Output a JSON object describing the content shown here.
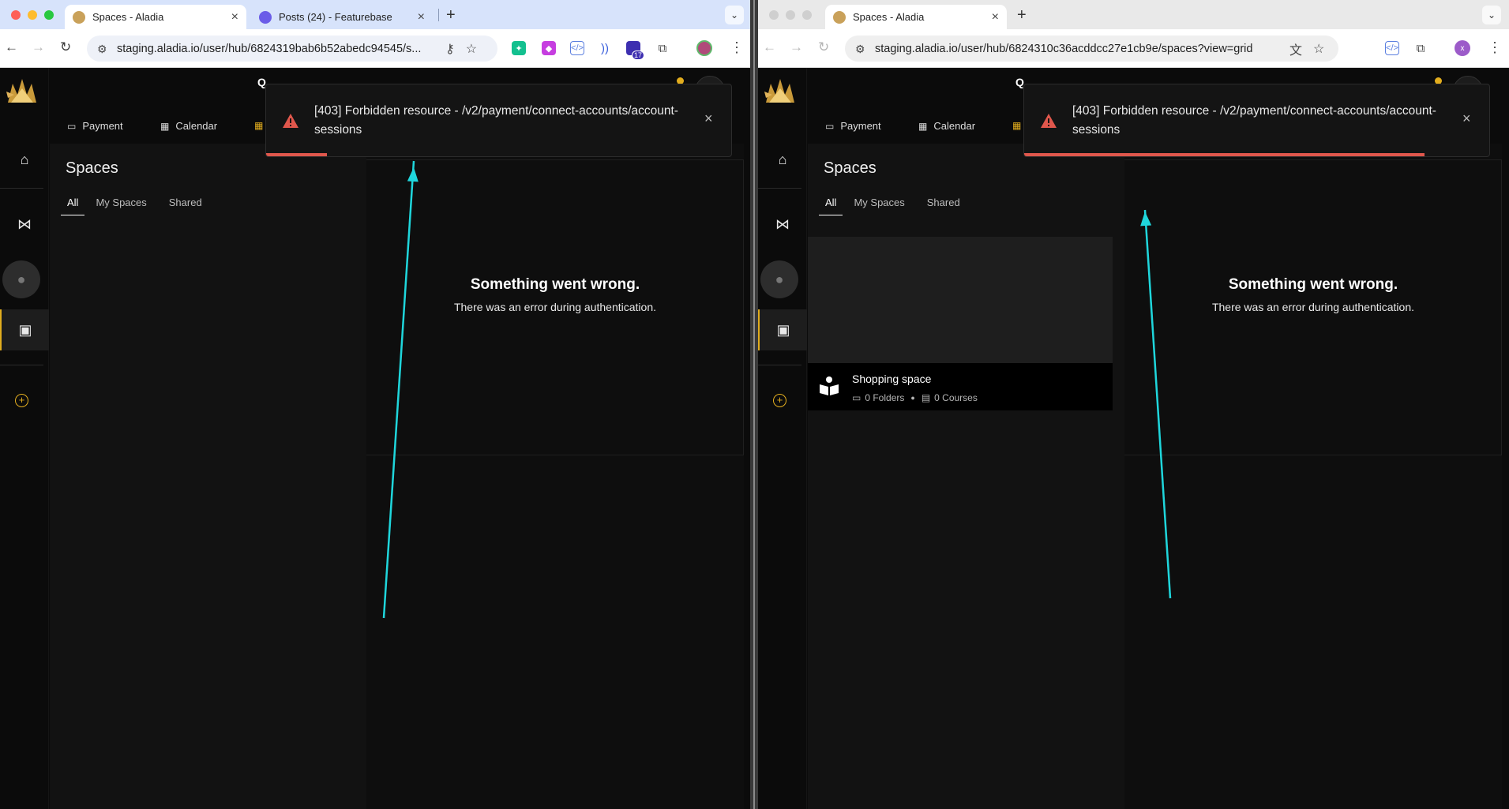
{
  "colors": {
    "accent": "#e2ad1e",
    "error": "#e0574c",
    "annotation_arrow": "#1fd6dc"
  },
  "left": {
    "tabs": [
      {
        "title": "Spaces - Aladia",
        "close": "×"
      },
      {
        "title": "Posts (24) - Featurebase",
        "close": "×"
      }
    ],
    "new_tab": "+",
    "url": "staging.aladia.io/user/hub/6824319bab6b52abedc94545/s...",
    "extension_badge": "17",
    "nav": {
      "payment": "Payment",
      "calendar": "Calendar"
    },
    "panel": {
      "title": "Spaces",
      "tabs": [
        "All",
        "My Spaces",
        "Shared"
      ]
    },
    "error": {
      "title": "Something went wrong.",
      "subtitle": "There was an error during authentication."
    },
    "toast": {
      "message": "[403] Forbidden resource - /v2/payment/connect-accounts/account-sessions",
      "close": "×",
      "progress_remaining": 0.13
    }
  },
  "right": {
    "tabs": [
      {
        "title": "Spaces - Aladia",
        "close": "×"
      }
    ],
    "new_tab": "+",
    "url": "staging.aladia.io/user/hub/6824310c36acddcc27e1cb9e/spaces?view=grid",
    "profile_initial": "x",
    "nav": {
      "payment": "Payment",
      "calendar": "Calendar"
    },
    "panel": {
      "title": "Spaces",
      "tabs": [
        "All",
        "My Spaces",
        "Shared"
      ],
      "space": {
        "name": "Shopping space",
        "folders": "0 Folders",
        "courses": "0 Courses"
      }
    },
    "error": {
      "title": "Something went wrong.",
      "subtitle": "There was an error during authentication."
    },
    "toast": {
      "message": "[403] Forbidden resource - /v2/payment/connect-accounts/account-sessions",
      "close": "×",
      "progress_remaining": 0.86
    }
  }
}
